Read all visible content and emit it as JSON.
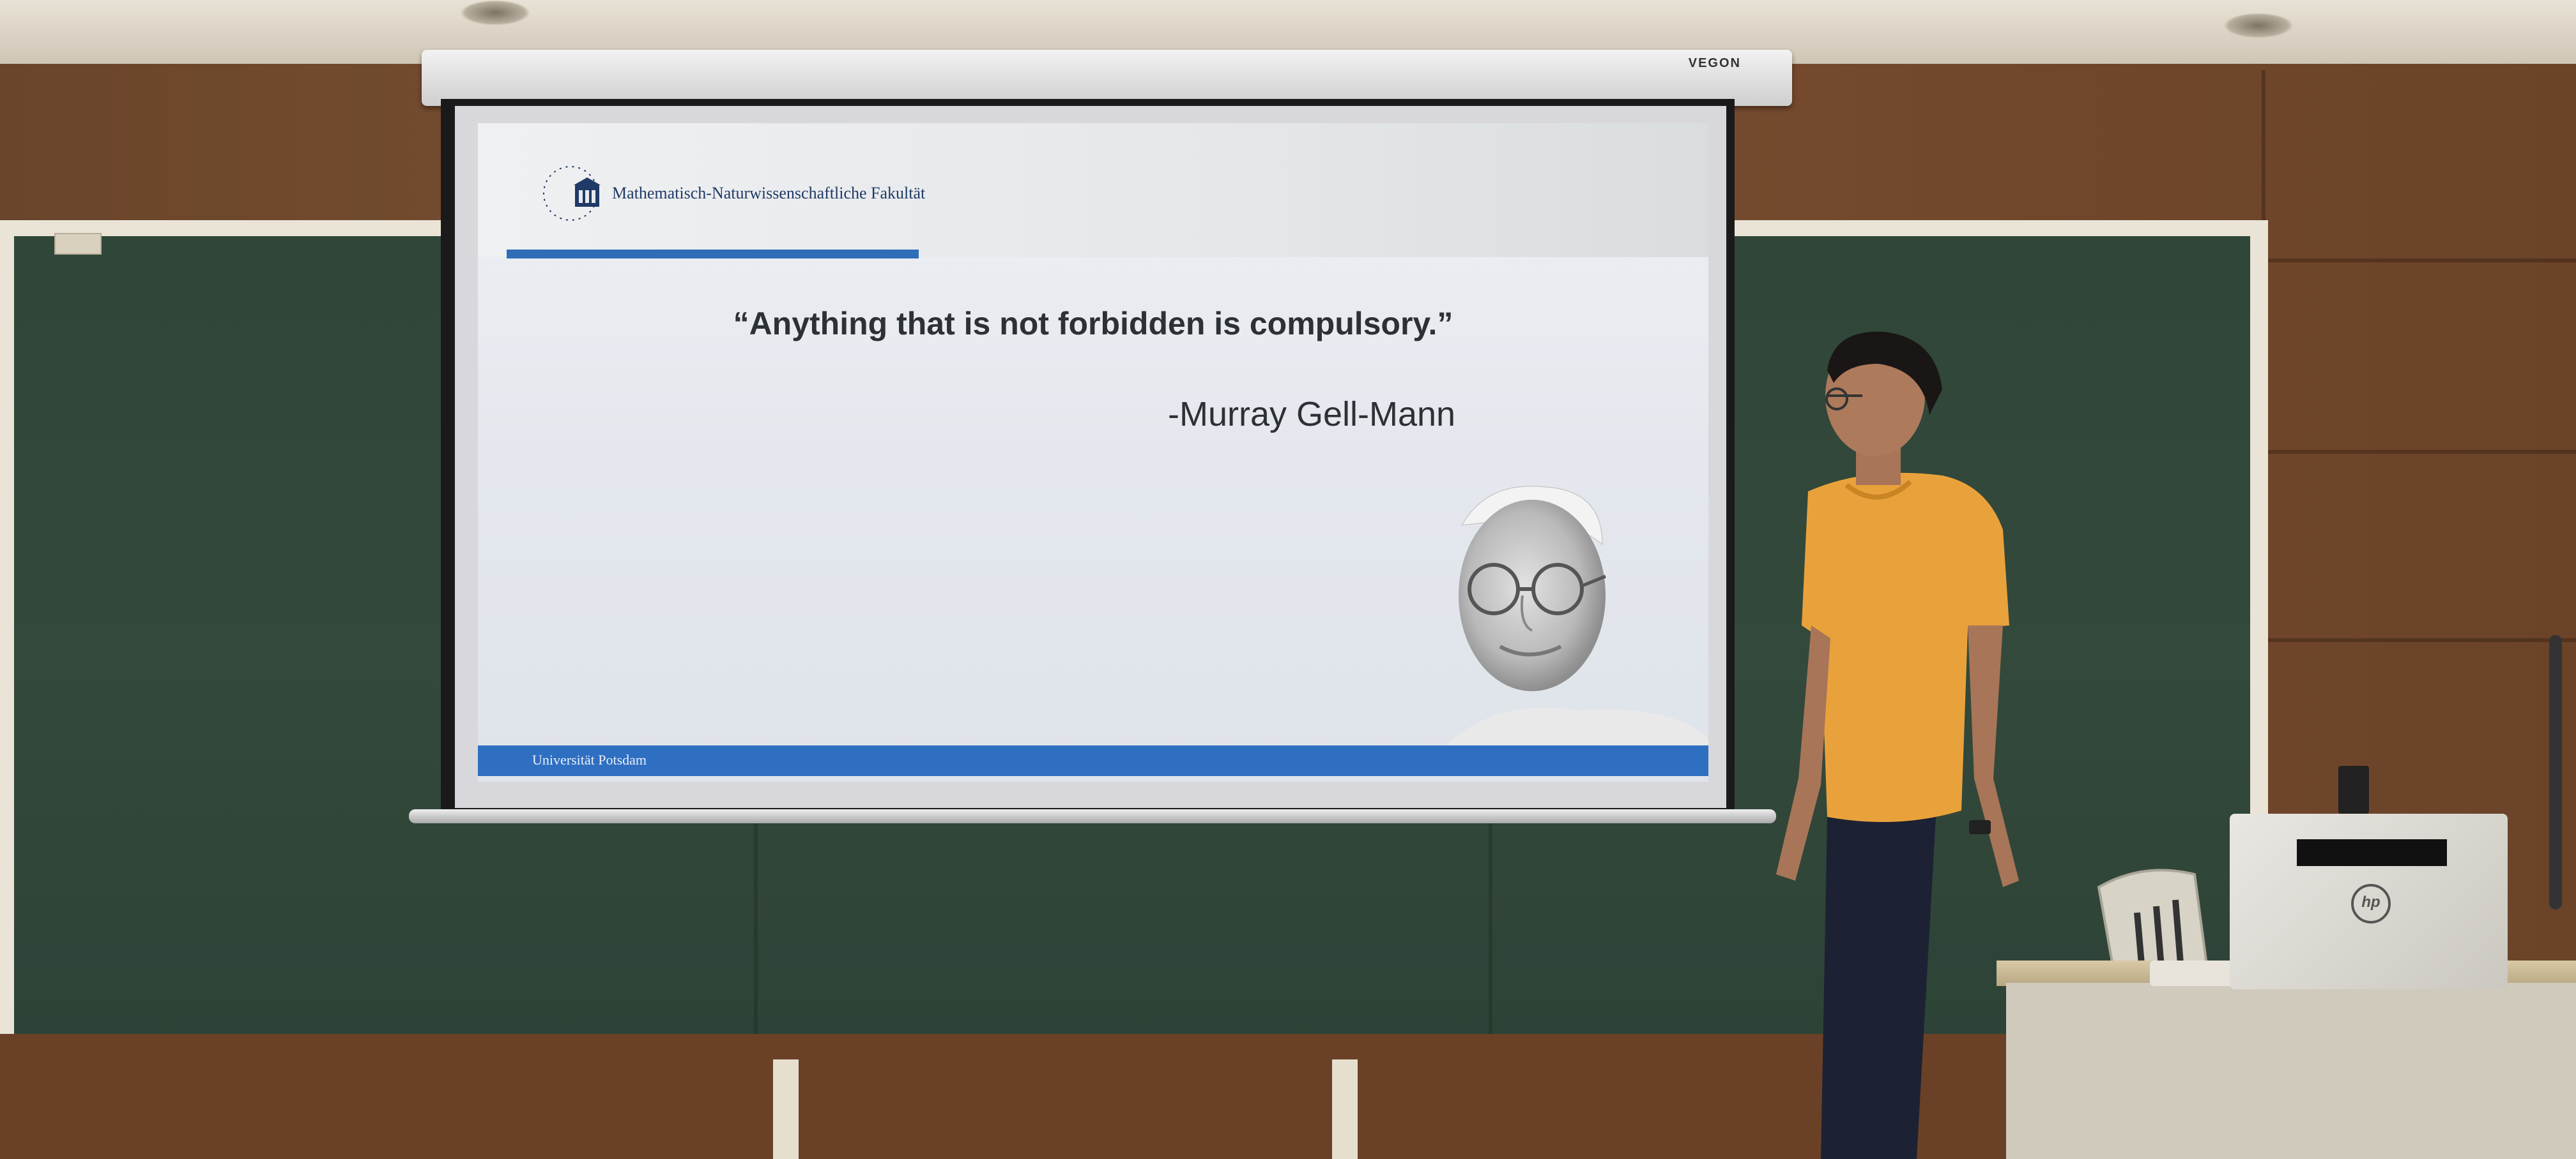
{
  "projector_screen": {
    "brand": "VEGON"
  },
  "slide": {
    "logo_text": "Universität Potsdam",
    "faculty_title": "Mathematisch-Naturwissenschaftliche Fakultät",
    "quote": "“Anything that is not forbidden is compulsory.”",
    "author": "-Murray Gell-Mann",
    "footer_text": "Universität Potsdam",
    "colors": {
      "accent_blue": "#2f6fc2",
      "text": "#2d3136"
    }
  },
  "scene": {
    "presenter_shirt_color": "#e9a23b",
    "chalkboard_color": "#2f4638",
    "laptop_brand": "hp"
  }
}
